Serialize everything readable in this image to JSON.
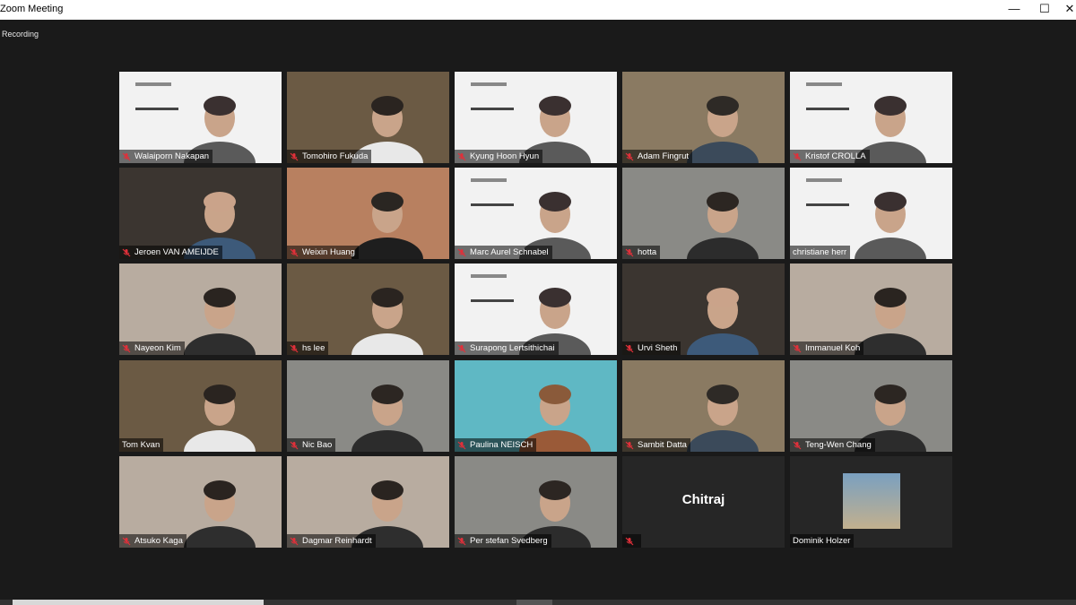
{
  "window": {
    "title": "Zoom Meeting",
    "recording_label": "Recording",
    "minimize": "—",
    "maximize": "☐",
    "close": "✕"
  },
  "participants": [
    {
      "name": "Walaiporn Nakapan",
      "muted": true,
      "scene": "slide"
    },
    {
      "name": "Tomohiro Fukuda",
      "muted": true,
      "scene": "library"
    },
    {
      "name": "Kyung Hoon Hyun",
      "muted": true,
      "scene": "slide"
    },
    {
      "name": "Adam Fingrut",
      "muted": true,
      "scene": "shelves"
    },
    {
      "name": "Kristof CROLLA",
      "muted": true,
      "scene": "slide"
    },
    {
      "name": "Jeroen VAN AMEIJDE",
      "muted": true,
      "scene": "dark"
    },
    {
      "name": "Weixin Huang",
      "muted": true,
      "scene": "sunset"
    },
    {
      "name": "Marc Aurel Schnabel",
      "muted": true,
      "scene": "slide"
    },
    {
      "name": "hotta",
      "muted": true,
      "scene": "office"
    },
    {
      "name": "christiane herr",
      "muted": false,
      "scene": "slide",
      "active": true
    },
    {
      "name": "Nayeon Kim",
      "muted": true,
      "scene": "room"
    },
    {
      "name": "hs lee",
      "muted": true,
      "scene": "library"
    },
    {
      "name": "Surapong Lertsithichai",
      "muted": true,
      "scene": "slide"
    },
    {
      "name": "Urvi Sheth",
      "muted": true,
      "scene": "dark"
    },
    {
      "name": "Immanuel Koh",
      "muted": true,
      "scene": "room"
    },
    {
      "name": "Tom Kvan",
      "muted": false,
      "scene": "library"
    },
    {
      "name": "Nic Bao",
      "muted": true,
      "scene": "office"
    },
    {
      "name": "Paulina  NEISCH",
      "muted": true,
      "scene": "teal"
    },
    {
      "name": "Sambit Datta",
      "muted": true,
      "scene": "shelves"
    },
    {
      "name": "Teng-Wen Chang",
      "muted": true,
      "scene": "office"
    },
    {
      "name": "Atsuko Kaga",
      "muted": true,
      "scene": "room"
    },
    {
      "name": "Dagmar Reinhardt",
      "muted": true,
      "scene": "room"
    },
    {
      "name": "Per stefan Svedberg",
      "muted": true,
      "scene": "office"
    },
    {
      "name": "",
      "display_name": "Chitraj",
      "muted": true,
      "scene": "blank"
    },
    {
      "name": "Dominik Holzer",
      "muted": false,
      "scene": "avatar"
    }
  ],
  "colors": {
    "background": "#1a1a1a",
    "active_speaker_outline": "#cfe35a",
    "muted_icon": "#e0303a"
  }
}
